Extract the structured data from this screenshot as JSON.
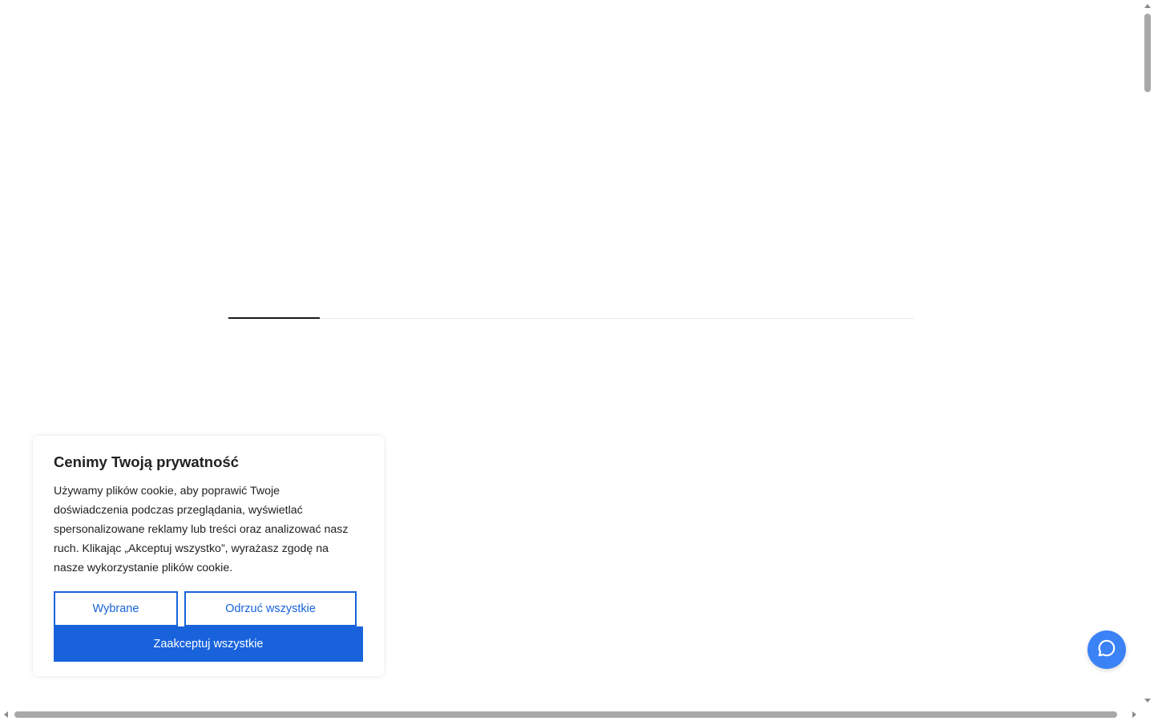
{
  "tabs": {
    "active_index": 0
  },
  "cookie_banner": {
    "title": "Cenimy Twoją prywatność",
    "description": "Używamy plików cookie, aby poprawić Twoje doświadczenia podczas przeglądania, wyświetlać spersonalizowane reklamy lub treści oraz analizować nasz ruch. Klikając „Akceptuj wszystko”, wyrażasz zgodę na nasze wykorzystanie plików cookie.",
    "selected_label": "Wybrane",
    "reject_label": "Odrzuć wszystkie",
    "accept_label": "Zaakceptuj wszystkie",
    "accent_color": "#1863dc"
  },
  "chat": {
    "icon": "chat-bubble-icon",
    "color": "#3b82f6"
  }
}
